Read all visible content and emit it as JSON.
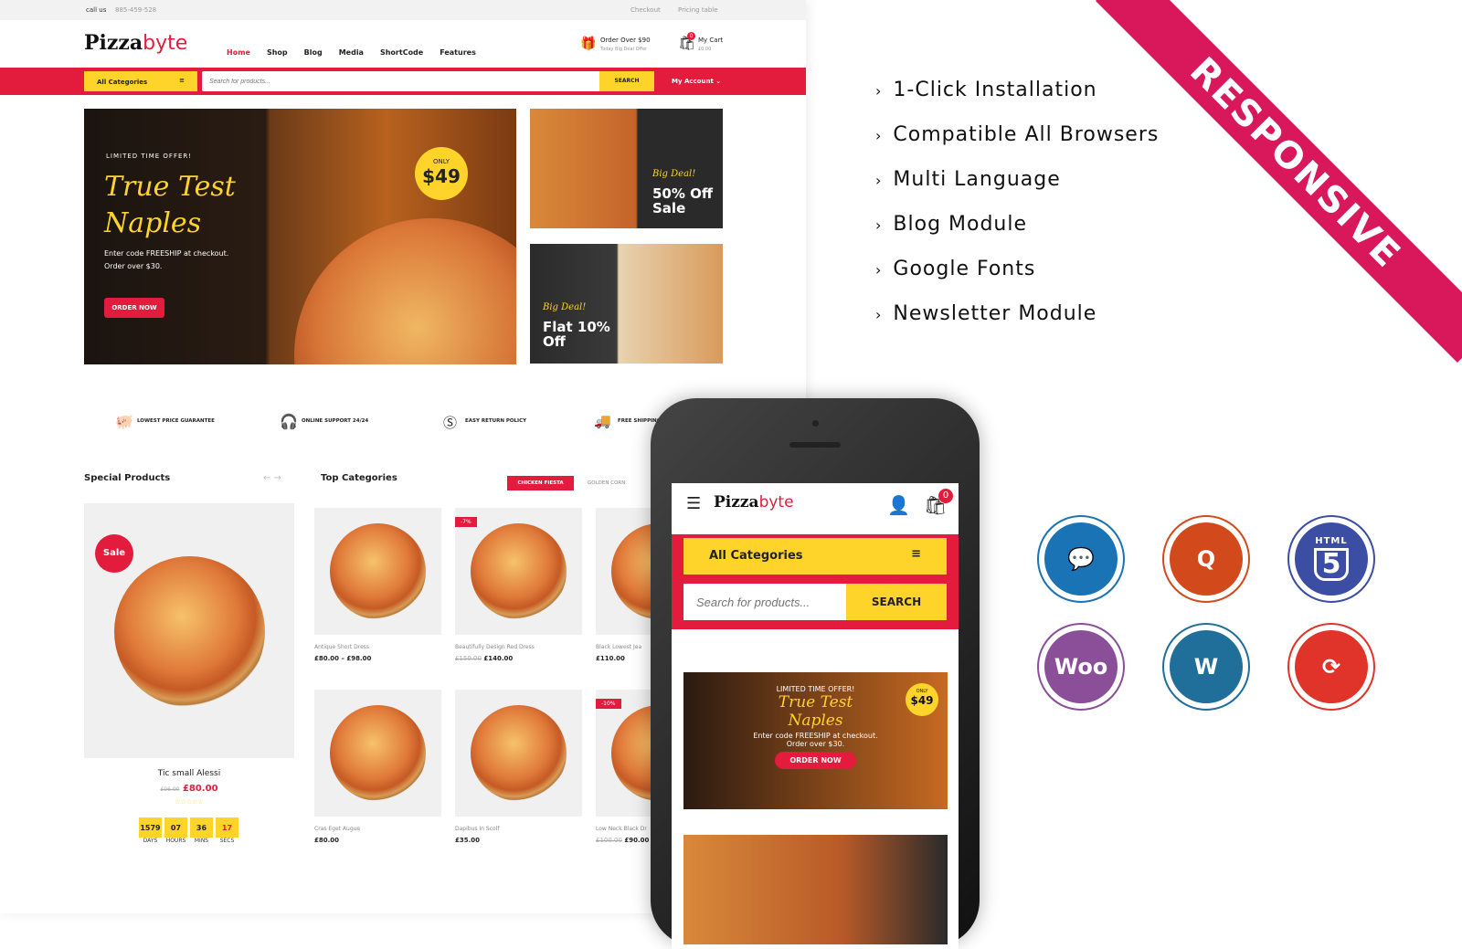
{
  "site": {
    "topbar": {
      "call": "call us",
      "phone": "885-459-528",
      "links": [
        "Checkout",
        "Pricing table"
      ]
    },
    "logo": {
      "part1": "Pizza",
      "part2": "byte"
    },
    "nav": [
      "Home",
      "Shop",
      "Blog",
      "Media",
      "ShortCode",
      "Features"
    ],
    "offer": {
      "title": "Order Over $90",
      "sub": "Today Big Deal Offer"
    },
    "cart": {
      "label": "My Cart",
      "amount": "£0.00",
      "count": "0"
    },
    "categories_label": "All Categories",
    "search": {
      "placeholder": "Search for products...",
      "button": "SEARCH"
    },
    "account": "My Account",
    "hero": {
      "kicker": "LIMITED TIME OFFER!",
      "title1": "True Test",
      "title2": "Naples",
      "text1": "Enter code FREESHIP at checkout.",
      "text2": "Order over $30.",
      "button": "ORDER NOW",
      "badge_only": "ONLY",
      "badge_price": "$49"
    },
    "banner1": {
      "kicker": "Big Deal!",
      "line1": "50% Off",
      "line2": "Sale"
    },
    "banner2": {
      "kicker": "Big Deal!",
      "line1": "Flat 10%",
      "line2": "Off"
    },
    "services": [
      "LOWEST PRICE GUARANTEE",
      "ONLINE SUPPORT 24/24",
      "EASY RETURN POLICY",
      "FREE SHIPPING W"
    ],
    "special": {
      "title": "Special Products",
      "sale": "Sale",
      "name": "Tic small Alessi",
      "old": "£96.00",
      "price": "£80.00",
      "countdown": [
        {
          "v": "1579",
          "l": "DAYS"
        },
        {
          "v": "07",
          "l": "HOURS"
        },
        {
          "v": "36",
          "l": "MINS"
        },
        {
          "v": "17",
          "l": "SECS"
        }
      ]
    },
    "top_categories": {
      "title": "Top Categories",
      "tabs": [
        "CHICKEN FIESTA",
        "GOLDEN CORN"
      ]
    },
    "products": [
      {
        "name": "Antique Short Dress",
        "old": "",
        "price": "£80.00 – £98.00",
        "badge": ""
      },
      {
        "name": "Beautifully Design Red Dress",
        "old": "£150.00",
        "price": "£140.00",
        "badge": "-7%"
      },
      {
        "name": "Black Lowest Jea",
        "old": "",
        "price": "£110.00",
        "badge": ""
      },
      {
        "name": "Cras Eget Augue",
        "old": "",
        "price": "£80.00",
        "badge": ""
      },
      {
        "name": "Dapibus In Scolf",
        "old": "",
        "price": "£35.00",
        "badge": ""
      },
      {
        "name": "Low Neck Black Dr",
        "old": "£100.00",
        "price": "£90.00",
        "badge": "-10%"
      }
    ]
  },
  "phone": {
    "logo1": "Pizza",
    "logo2": "byte",
    "cart_count": "0",
    "categories": "All Categories",
    "search_placeholder": "Search for products...",
    "search_button": "SEARCH",
    "hero": {
      "kicker": "LIMITED TIME OFFER!",
      "title1": "True Test",
      "title2": "Naples",
      "text1": "Enter code FREESHIP at checkout.",
      "text2": "Order over $30.",
      "button": "ORDER NOW",
      "badge_only": "ONLY",
      "badge_price": "$49"
    }
  },
  "features": [
    "1-Click Installation",
    "Compatible All Browsers",
    "Multi Language",
    "Blog Module",
    "Google Fonts",
    "Newsletter Module"
  ],
  "ribbon": "RESPONSIVE",
  "tech_icons": [
    {
      "name": "chef-icon",
      "color": "#1a73b5"
    },
    {
      "name": "q-icon",
      "color": "#d24a1c"
    },
    {
      "name": "html5-icon",
      "color": "#3b4ea3",
      "text": "HTML"
    },
    {
      "name": "woo-icon",
      "color": "#8b4f9a",
      "text": "Woo"
    },
    {
      "name": "wordpress-icon",
      "color": "#1f6f9a",
      "text": "W"
    },
    {
      "name": "update-icon",
      "color": "#e0332a"
    }
  ],
  "colors": {
    "accent": "#e31b3d",
    "yellow": "#ffd42a"
  }
}
